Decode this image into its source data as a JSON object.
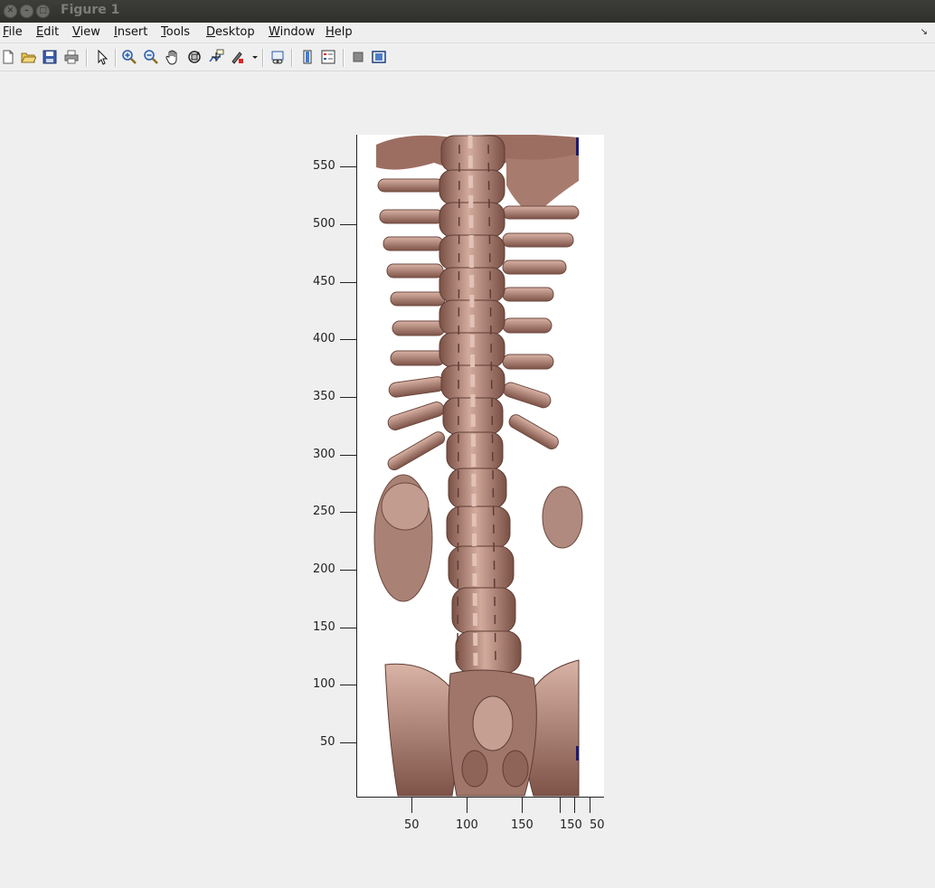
{
  "window": {
    "title": "Figure 1"
  },
  "menu": {
    "items": [
      {
        "label": "File",
        "underline": "F",
        "rest": "ile"
      },
      {
        "label": "Edit",
        "underline": "E",
        "rest": "dit"
      },
      {
        "label": "View",
        "underline": "V",
        "rest": "iew"
      },
      {
        "label": "Insert",
        "underline": "I",
        "rest": "nsert"
      },
      {
        "label": "Tools",
        "underline": "T",
        "rest": "ools"
      },
      {
        "label": "Desktop",
        "underline": "D",
        "rest": "esktop"
      },
      {
        "label": "Window",
        "underline": "W",
        "rest": "indow"
      },
      {
        "label": "Help",
        "underline": "H",
        "rest": "elp"
      }
    ]
  },
  "toolbar": {
    "icons": [
      "new-figure-icon",
      "open-file-icon",
      "save-icon",
      "print-icon",
      "pointer-icon",
      "zoom-in-icon",
      "zoom-out-icon",
      "pan-icon",
      "rotate-3d-icon",
      "data-cursor-icon",
      "brush-icon",
      "link-plot-icon",
      "colorbar-icon",
      "legend-icon",
      "hide-plot-tools-icon",
      "show-plot-tools-icon"
    ]
  },
  "axes": {
    "y_ticks": [
      "550",
      "500",
      "450",
      "400",
      "350",
      "300",
      "250",
      "200",
      "150",
      "100",
      "50"
    ],
    "x_ticks": [
      "50",
      "100",
      "150",
      "150",
      "50"
    ]
  },
  "colors": {
    "bone": "#b4877a",
    "bone_dark": "#6e4a40",
    "bone_light": "#d9b3a6",
    "axes_bg": "#ffffff",
    "figure_bg": "#efefef"
  }
}
